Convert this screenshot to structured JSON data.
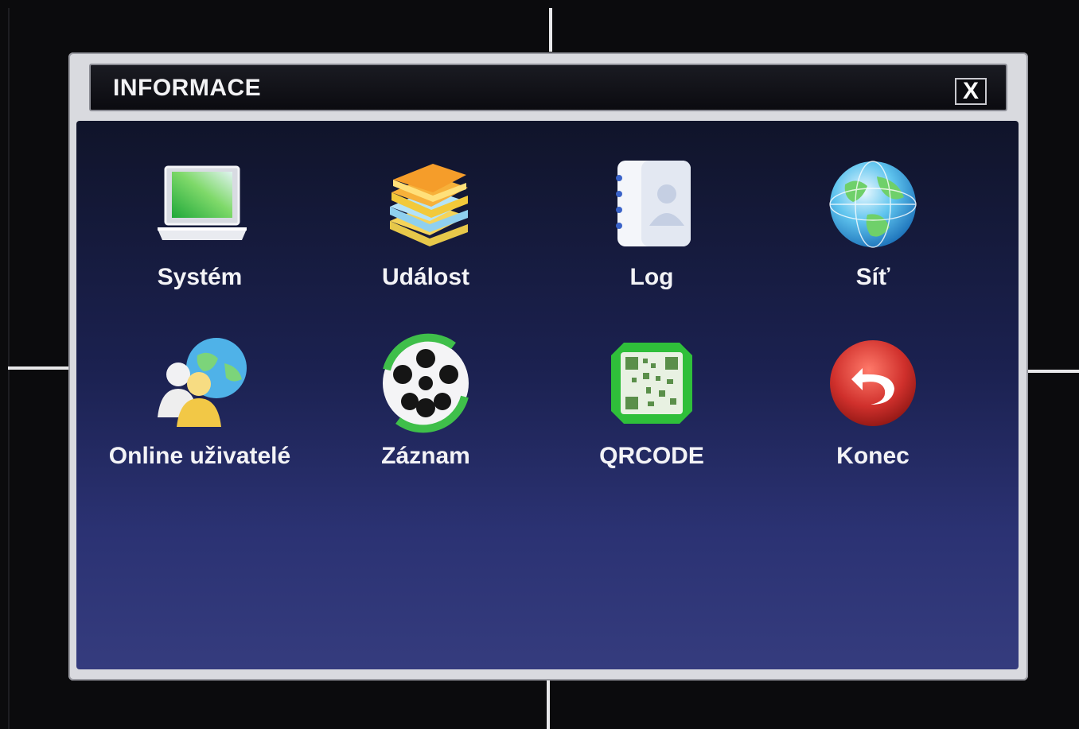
{
  "dialog": {
    "title": "INFORMACE",
    "close_glyph": "X"
  },
  "items": [
    {
      "label": "Systém",
      "icon": "laptop-icon"
    },
    {
      "label": "Událost",
      "icon": "books-icon"
    },
    {
      "label": "Log",
      "icon": "address-book-icon"
    },
    {
      "label": "Síť",
      "icon": "globe-icon"
    },
    {
      "label": "Online uživatelé",
      "icon": "online-users-icon"
    },
    {
      "label": "Záznam",
      "icon": "film-reel-icon"
    },
    {
      "label": "QRCODE",
      "icon": "qr-code-icon"
    },
    {
      "label": "Konec",
      "icon": "exit-icon"
    }
  ],
  "colors": {
    "panel_top": "#10142a",
    "panel_bottom": "#353c7e",
    "frame": "#d9dadf",
    "exit_red": "#d0302c",
    "qr_green": "#2fbf3a"
  }
}
